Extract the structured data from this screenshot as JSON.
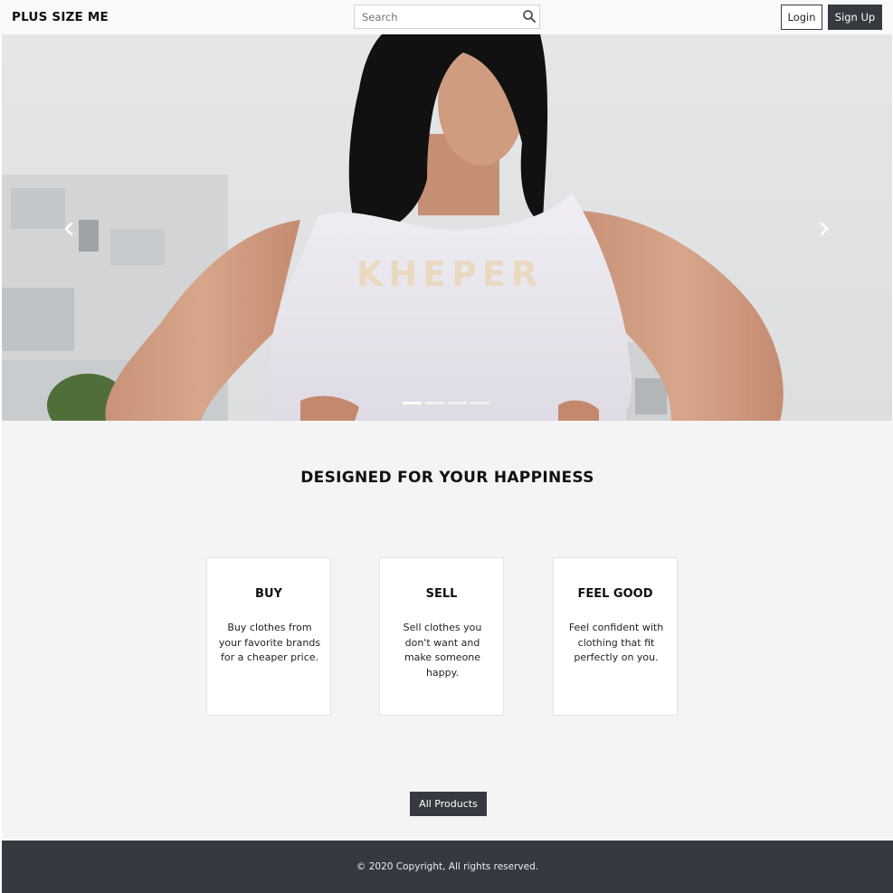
{
  "navbar": {
    "brand": "PLUS SIZE ME",
    "search": {
      "placeholder": "Search",
      "value": ""
    },
    "login_label": "Login",
    "signup_label": "Sign Up"
  },
  "hero": {
    "slide_count": 4,
    "active_slide": 1,
    "shirt_print": "KHEPER"
  },
  "features": {
    "title": "DESIGNED FOR YOUR HAPPINESS",
    "cards": [
      {
        "title": "BUY",
        "text": "Buy clothes from your favorite brands for a cheaper price."
      },
      {
        "title": "SELL",
        "text": "Sell clothes you don't want and make someone happy."
      },
      {
        "title": "FEEL GOOD",
        "text": "Feel confident with clothing that fit perfectly on you."
      }
    ],
    "all_products_label": "All Products"
  },
  "footer": {
    "copyright": "© 2020 Copyright, All rights reserved."
  },
  "colors": {
    "dark": "#343a40",
    "navbar_bg": "#f8f9fa",
    "section_bg": "#f4f4f4"
  }
}
